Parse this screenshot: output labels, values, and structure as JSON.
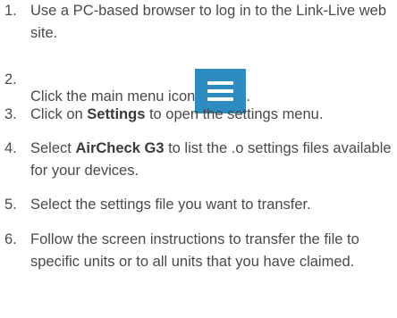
{
  "steps": [
    {
      "number": "1.",
      "text": "Use a PC-based browser to log in to the Link-Live web site."
    },
    {
      "number": "2.",
      "text_before": "Click the main menu icon",
      "icon": "hamburger-menu-icon",
      "icon_color": "#2e8bc0",
      "text_after": "."
    },
    {
      "number": "3.",
      "text_before": "Click on ",
      "bold": "Settings",
      "text_after": " to open the settings menu."
    },
    {
      "number": "4.",
      "text_before": "Select ",
      "bold": "AirCheck G3",
      "text_after": " to list the .o settings files available for your devices."
    },
    {
      "number": "5.",
      "text": "Select the settings file you want to transfer."
    },
    {
      "number": "6.",
      "text": "Follow the screen instructions to transfer the file to specific units or to all units that you have claimed."
    }
  ]
}
